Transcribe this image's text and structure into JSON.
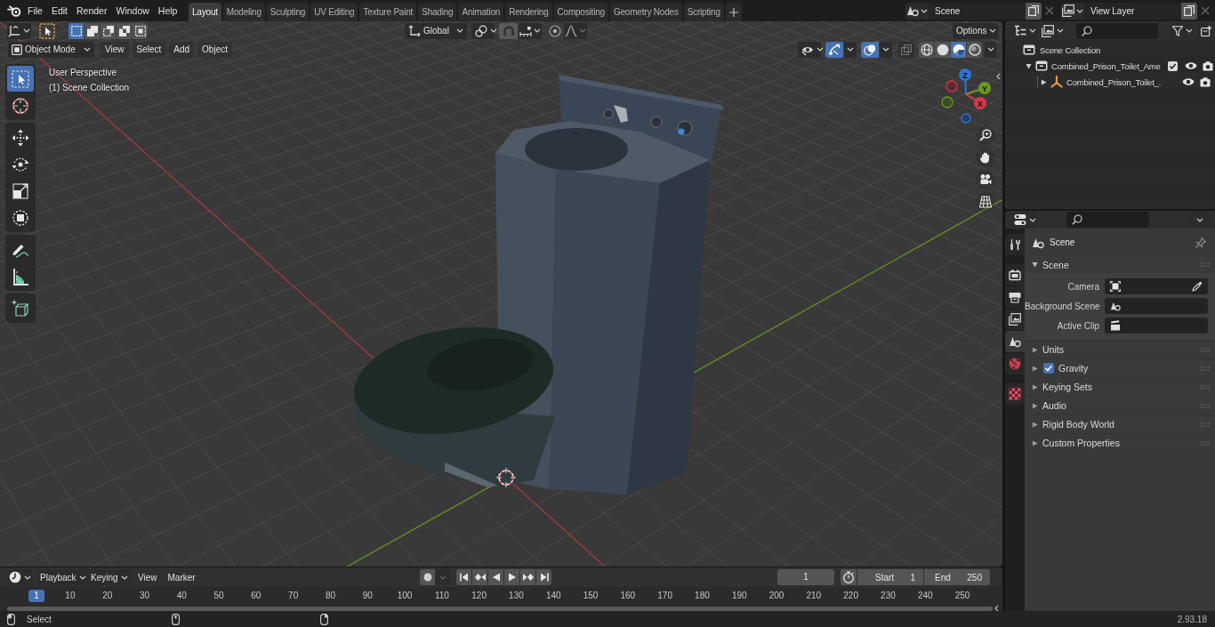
{
  "top_bar": {
    "menus": [
      "File",
      "Edit",
      "Render",
      "Window",
      "Help"
    ],
    "workspaces": [
      {
        "label": "Layout",
        "selected": true
      },
      {
        "label": "Modeling",
        "selected": false
      },
      {
        "label": "Sculpting",
        "selected": false
      },
      {
        "label": "UV Editing",
        "selected": false
      },
      {
        "label": "Texture Paint",
        "selected": false
      },
      {
        "label": "Shading",
        "selected": false
      },
      {
        "label": "Animation",
        "selected": false
      },
      {
        "label": "Rendering",
        "selected": false
      },
      {
        "label": "Compositing",
        "selected": false
      },
      {
        "label": "Geometry Nodes",
        "selected": false
      },
      {
        "label": "Scripting",
        "selected": false
      }
    ],
    "scene": "Scene",
    "view_layer": "View Layer"
  },
  "viewport": {
    "tool_header": {
      "select_modes": [
        {
          "kind": "set",
          "selected": true
        },
        {
          "kind": "extend",
          "selected": false
        },
        {
          "kind": "subtract",
          "selected": false
        },
        {
          "kind": "invert",
          "selected": false
        },
        {
          "kind": "intersect",
          "selected": false
        }
      ],
      "orientation": "Global",
      "options": "Options"
    },
    "header": {
      "mode": "Object Mode",
      "menus": [
        "View",
        "Select",
        "Add",
        "Object"
      ],
      "gizmos_on": true,
      "overlays_on": true,
      "shading": [
        {
          "kind": "wireframe",
          "selected": false
        },
        {
          "kind": "solid",
          "selected": false
        },
        {
          "kind": "material",
          "selected": true
        },
        {
          "kind": "rendered",
          "selected": false
        }
      ]
    },
    "info": [
      "User Perspective",
      "(1) Scene Collection"
    ],
    "tool_groups": [
      {
        "tools": [
          {
            "kind": "select_box",
            "selected": true
          },
          {
            "kind": "cursor",
            "selected": false
          }
        ]
      },
      {
        "tools": [
          {
            "kind": "move",
            "selected": false
          },
          {
            "kind": "rotate",
            "selected": false
          },
          {
            "kind": "scale",
            "selected": false
          },
          {
            "kind": "transform",
            "selected": false
          }
        ]
      },
      {
        "tools": [
          {
            "kind": "annotate",
            "selected": false
          },
          {
            "kind": "measure",
            "selected": false
          }
        ]
      },
      {
        "tools": [
          {
            "kind": "add_cube",
            "selected": false
          }
        ]
      }
    ],
    "gizmo_axes": [
      {
        "kind": "z",
        "label": "Z"
      },
      {
        "kind": "y",
        "label": "Y"
      },
      {
        "kind": "x",
        "label": "X"
      }
    ]
  },
  "timeline": {
    "menus": [
      {
        "label": "Playback",
        "kind": "dropdown"
      },
      {
        "label": "Keying",
        "kind": "dropdown"
      },
      {
        "label": "View",
        "kind": "menu"
      },
      {
        "label": "Marker",
        "kind": "menu"
      }
    ],
    "current_frame": "1",
    "start": {
      "label": "Start",
      "value": "1"
    },
    "end": {
      "label": "End",
      "value": "250"
    },
    "ruler": [
      {
        "label": "1",
        "selected": true
      },
      {
        "label": "10",
        "selected": false
      },
      {
        "label": "20",
        "selected": false
      },
      {
        "label": "30",
        "selected": false
      },
      {
        "label": "40",
        "selected": false
      },
      {
        "label": "50",
        "selected": false
      },
      {
        "label": "60",
        "selected": false
      },
      {
        "label": "70",
        "selected": false
      },
      {
        "label": "80",
        "selected": false
      },
      {
        "label": "90",
        "selected": false
      },
      {
        "label": "100",
        "selected": false
      },
      {
        "label": "110",
        "selected": false
      },
      {
        "label": "120",
        "selected": false
      },
      {
        "label": "130",
        "selected": false
      },
      {
        "label": "140",
        "selected": false
      },
      {
        "label": "150",
        "selected": false
      },
      {
        "label": "160",
        "selected": false
      },
      {
        "label": "170",
        "selected": false
      },
      {
        "label": "180",
        "selected": false
      },
      {
        "label": "190",
        "selected": false
      },
      {
        "label": "200",
        "selected": false
      },
      {
        "label": "210",
        "selected": false
      },
      {
        "label": "220",
        "selected": false
      },
      {
        "label": "230",
        "selected": false
      },
      {
        "label": "240",
        "selected": false
      },
      {
        "label": "250",
        "selected": false
      }
    ]
  },
  "status_bar": {
    "hint": "Select",
    "version": "2.93.18"
  },
  "outliner": {
    "tree": [
      {
        "label": "Scene Collection",
        "kind": "scene_collection",
        "children": [
          {
            "label": "Combined_Prison_Toilet_Ame",
            "kind": "collection",
            "expanded": true,
            "checked": true,
            "children": [
              {
                "label": "Combined_Prison_Toilet_.",
                "kind": "object",
                "expanded": false
              }
            ]
          }
        ]
      }
    ]
  },
  "properties": {
    "tab_groups": [
      {
        "tabs": [
          {
            "kind": "tool",
            "selected": false
          }
        ]
      },
      {
        "tabs": [
          {
            "kind": "render",
            "selected": false
          },
          {
            "kind": "output",
            "selected": false
          },
          {
            "kind": "view_layer",
            "selected": false
          },
          {
            "kind": "scene",
            "selected": true
          },
          {
            "kind": "world",
            "selected": false
          }
        ]
      },
      {
        "tabs": [
          {
            "kind": "texture",
            "selected": false
          }
        ]
      }
    ],
    "context": "Scene",
    "panel": {
      "title": "Scene",
      "expanded": true,
      "fields": [
        {
          "label": "Camera",
          "kind": "camera"
        },
        {
          "label": "Background Scene",
          "kind": "scene"
        },
        {
          "label": "Active Clip",
          "kind": "clip"
        }
      ]
    },
    "subpanels": [
      {
        "title": "Units",
        "kind": "plain",
        "expanded": false
      },
      {
        "title": "Gravity",
        "kind": "toggle",
        "checked": true,
        "expanded": false
      },
      {
        "title": "Keying Sets",
        "kind": "plain",
        "expanded": false
      },
      {
        "title": "Audio",
        "kind": "plain",
        "expanded": false
      },
      {
        "title": "Rigid Body World",
        "kind": "plain",
        "expanded": false
      },
      {
        "title": "Custom Properties",
        "kind": "plain",
        "expanded": false
      }
    ]
  }
}
